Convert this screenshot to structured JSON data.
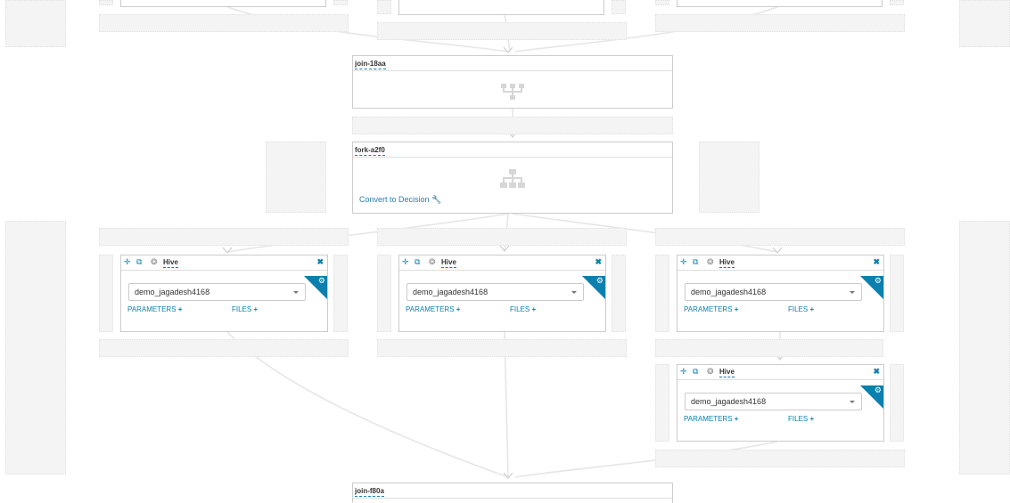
{
  "workflow": {
    "join_top": {
      "name": "join-18aa",
      "icon": "join-icon"
    },
    "fork": {
      "name": "fork-a2f0",
      "icon": "fork-icon",
      "convert_label": "Convert to Decision",
      "convert_icon": "wrench-icon"
    },
    "join_bottom": {
      "name": "join-f80a"
    },
    "actions": [
      {
        "type": "Hive",
        "database": "demo_jagadesh4168",
        "parameters_label": "PARAMETERS",
        "files_label": "FILES",
        "plus": "+"
      },
      {
        "type": "Hive",
        "database": "demo_jagadesh4168",
        "parameters_label": "PARAMETERS",
        "files_label": "FILES",
        "plus": "+"
      },
      {
        "type": "Hive",
        "database": "demo_jagadesh4168",
        "parameters_label": "PARAMETERS",
        "files_label": "FILES",
        "plus": "+"
      },
      {
        "type": "Hive",
        "database": "demo_jagadesh4168",
        "parameters_label": "PARAMETERS",
        "files_label": "FILES",
        "plus": "+"
      }
    ],
    "icons": {
      "move": "move-icon",
      "copy": "copy-icon",
      "type": "hive-icon",
      "close": "close-icon",
      "settings": "gears-icon",
      "expand": "expand-icon"
    },
    "colors": {
      "accent": "#0b7fad",
      "link": "#2a7db5",
      "edge": "#e6e6e6",
      "drop_zone": "#f4f4f4"
    }
  }
}
